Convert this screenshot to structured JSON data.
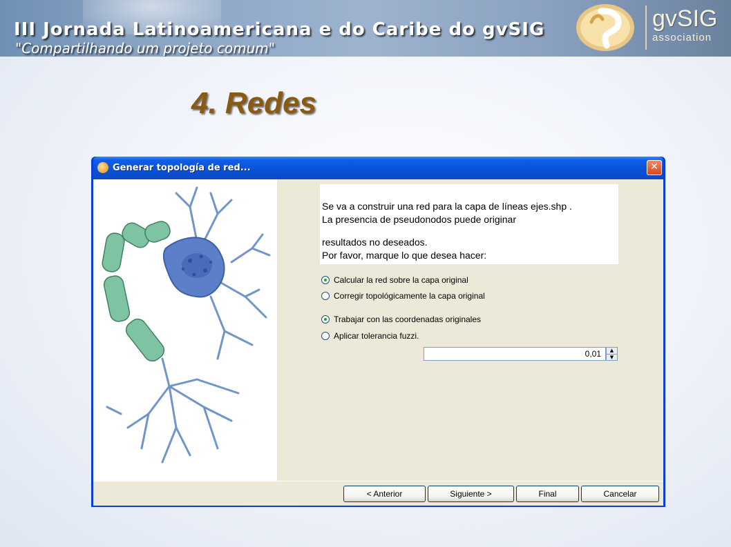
{
  "banner": {
    "title_line1": "III Jornada Latinoamericana e do Caribe do gvSIG",
    "title_line2": "\"Compartilhando um projeto comum\"",
    "logo_gv": "gvSIG",
    "logo_assoc": "association"
  },
  "slide": {
    "title": "4. Redes"
  },
  "dialog": {
    "title": "Generar topología de red...",
    "close_label": "✕",
    "info_lines": [
      "Se va a construir una red para la capa de líneas ejes.shp .",
      "La presencia de pseudonodos puede originar",
      "resultados no deseados.",
      "Por favor, marque lo que desea hacer:"
    ],
    "options": {
      "calc_original": {
        "label": "Calcular la red sobre la capa original",
        "checked": true
      },
      "correct_topology": {
        "label": "Corregir topológicamente la capa original",
        "checked": false
      },
      "work_original_coords": {
        "label": "Trabajar con las coordenadas originales",
        "checked": true
      },
      "apply_tolerance": {
        "label": "Aplicar tolerancia fuzzi.",
        "checked": false
      }
    },
    "tolerance_value": "0,01",
    "buttons": {
      "previous": "< Anterior",
      "next": "Siguiente >",
      "final": "Final",
      "cancel": "Cancelar"
    }
  },
  "colors": {
    "title_bar": "#0a51d8",
    "dialog_bg": "#ece9d8",
    "slide_title": "#8a5a12"
  }
}
